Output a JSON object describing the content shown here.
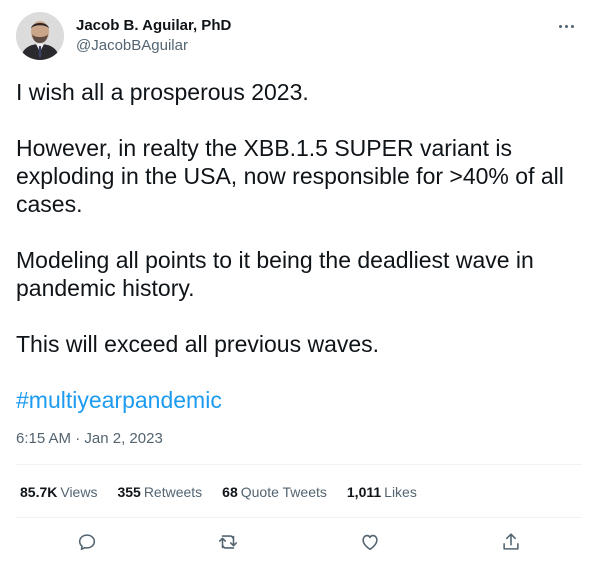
{
  "user": {
    "display_name": "Jacob B. Aguilar, PhD",
    "handle": "@JacobBAguilar",
    "avatar_icon": "profile-photo"
  },
  "tweet": {
    "paragraphs": [
      "I wish all a prosperous 2023.",
      "However, in realty the XBB.1.5 SUPER variant is exploding in the USA, now responsible for >40% of all cases.",
      "Modeling all points to it being the deadliest wave in pandemic history.",
      "This will exceed all previous waves."
    ],
    "hashtag": "#multiyearpandemic",
    "time": "6:15 AM",
    "separator": "·",
    "date": "Jan 2, 2023"
  },
  "stats": {
    "views_count": "85.7K",
    "views_label": "Views",
    "retweets_count": "355",
    "retweets_label": "Retweets",
    "quotes_count": "68",
    "quotes_label": "Quote Tweets",
    "likes_count": "1,011",
    "likes_label": "Likes"
  },
  "actions": {
    "reply_icon": "reply-icon",
    "retweet_icon": "retweet-icon",
    "like_icon": "heart-icon",
    "share_icon": "share-icon"
  },
  "colors": {
    "text": "#0f1419",
    "secondary": "#536471",
    "link": "#1d9bf0",
    "divider": "#eff3f4"
  }
}
